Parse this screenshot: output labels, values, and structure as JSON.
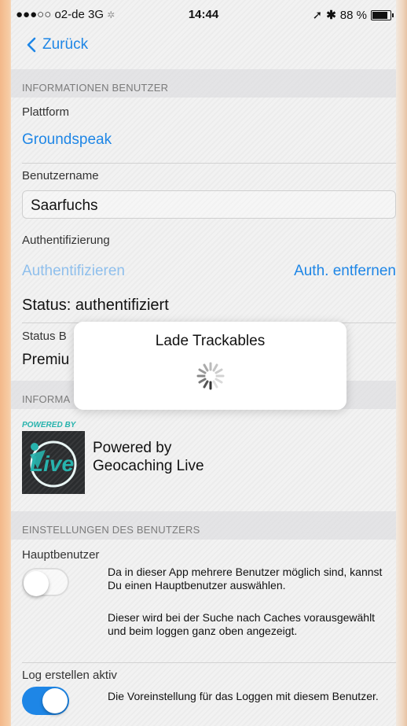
{
  "statusbar": {
    "carrier": "●●●○○ o2-de  3G",
    "time": "14:44",
    "battery": "88 %"
  },
  "nav": {
    "back_label": "Zurück"
  },
  "section_user_info": {
    "header": "INFORMATIONEN BENUTZER"
  },
  "platform": {
    "label": "Plattform",
    "value": "Groundspeak"
  },
  "username": {
    "label": "Benutzername",
    "value": "Saarfuchs"
  },
  "auth": {
    "label": "Authentifizierung",
    "authenticate": "Authentifizieren",
    "remove": "Auth. entfernen",
    "status": "Status: authentifiziert"
  },
  "status_b": {
    "label": "Status B",
    "value": "Premiu"
  },
  "section_info2": {
    "header": "INFORMA"
  },
  "powered": {
    "badge": "POWERED BY",
    "logo_text": "Live",
    "line1": "Powered by",
    "line2": "Geocaching Live"
  },
  "section_settings": {
    "header": "EINSTELLUNGEN DES BENUTZERS"
  },
  "main_user": {
    "label": "Hauptbenutzer",
    "desc1": "Da in dieser App mehrere Benutzer möglich sind, kannst Du einen Hauptbenutzer auswählen.",
    "desc2": "Dieser wird bei der Suche nach Caches vorausgewählt und beim loggen ganz oben angezeigt.",
    "enabled": false
  },
  "log_active": {
    "label": "Log erstellen aktiv",
    "desc": "Die Voreinstellung für das Loggen mit diesem Benutzer.",
    "enabled": true
  },
  "dialog": {
    "title": "Lade Trackables"
  },
  "colors": {
    "accent": "#1e86e6",
    "accent_disabled": "#8fbfec"
  }
}
